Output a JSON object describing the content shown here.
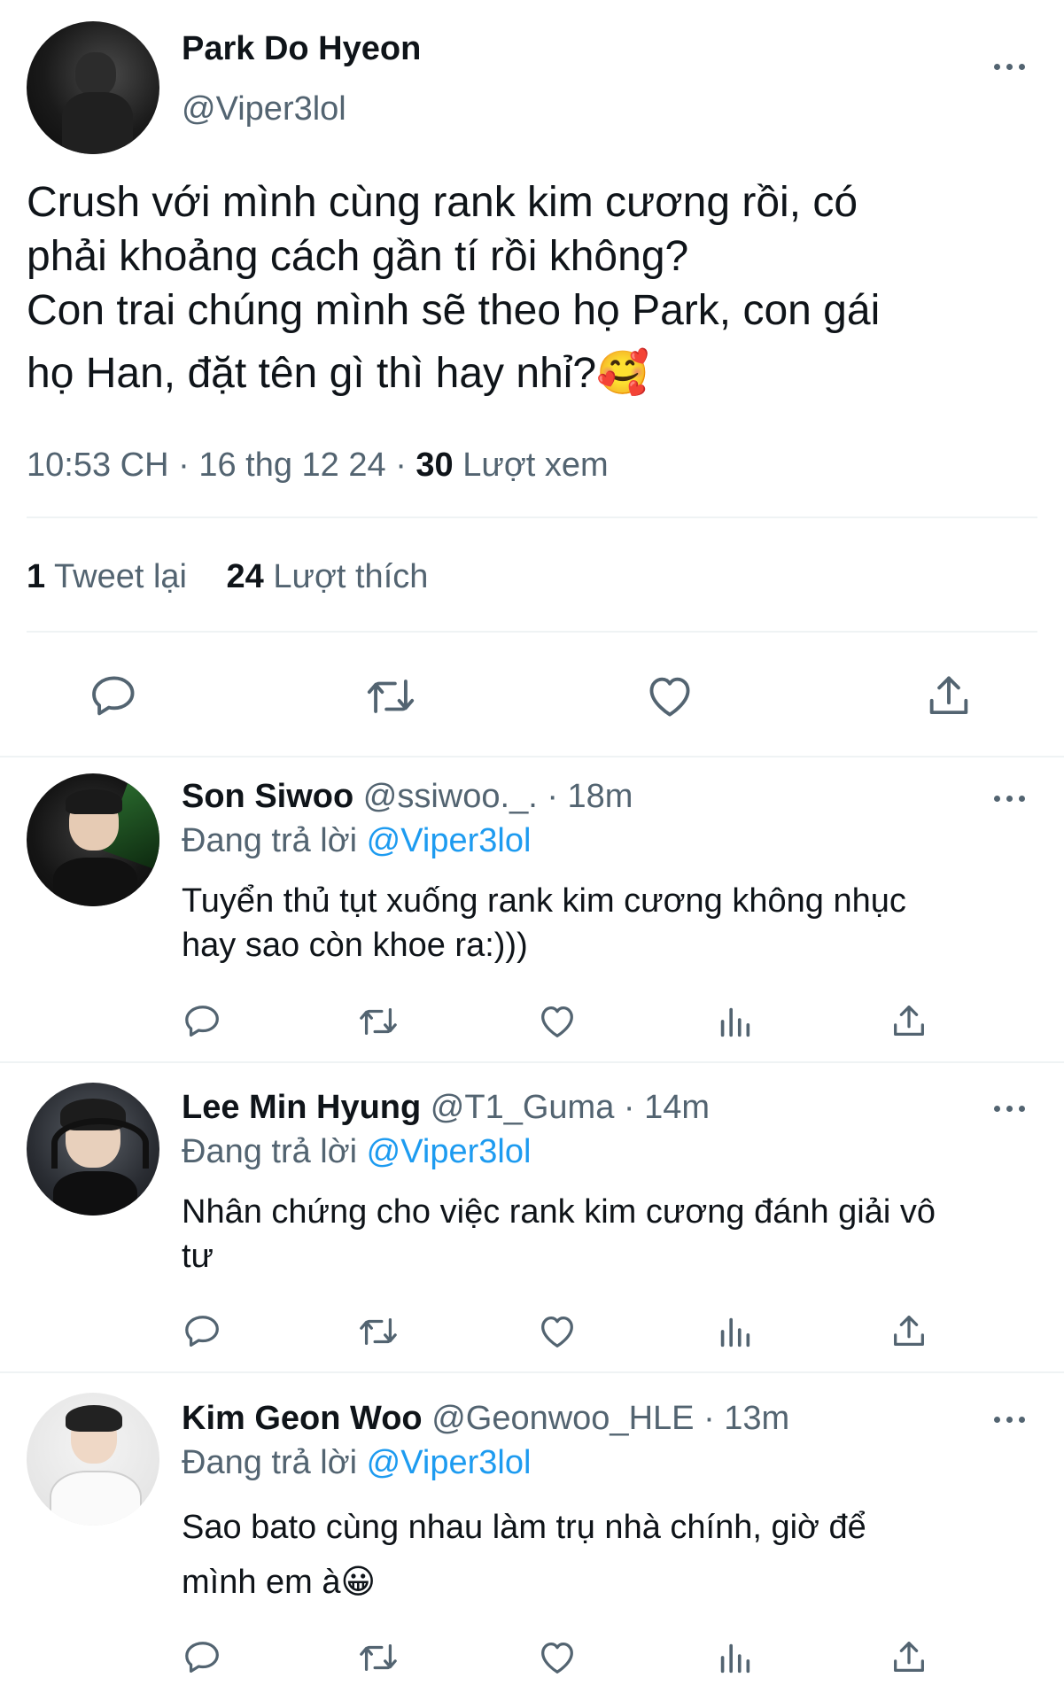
{
  "main_tweet": {
    "author_name": "Park Do Hyeon",
    "handle": "@Viper3lol",
    "text_lines": [
      "Crush với mình cùng rank kim cương rồi, có",
      "phải khoảng cách gần tí rồi không?",
      "Con trai chúng mình sẽ theo họ Park, con gái",
      "họ Han, đặt tên gì thì hay nhỉ?"
    ],
    "emoji": "🥰",
    "time": "10:53 CH",
    "date": "16 thg 12 24",
    "separator": "·",
    "views_count": "30",
    "views_label": "Lượt xem",
    "retweets_count": "1",
    "retweets_label": "Tweet lại",
    "likes_count": "24",
    "likes_label": "Lượt thích"
  },
  "replies": [
    {
      "author_name": "Son Siwoo",
      "handle": "@ssiwoo._.",
      "time": "· 18m",
      "replying_prefix": "Đang trả lời",
      "replying_to": "@Viper3lol",
      "text_lines": [
        "Tuyển thủ tụt xuống rank kim cương không nhục",
        "hay sao còn khoe ra:)))"
      ],
      "emoji": ""
    },
    {
      "author_name": "Lee Min Hyung",
      "handle": "@T1_Guma",
      "time": "· 14m",
      "replying_prefix": "Đang trả lời",
      "replying_to": "@Viper3lol",
      "text_lines": [
        "Nhân chứng cho việc rank kim cương đánh giải vô",
        "tư"
      ],
      "emoji": ""
    },
    {
      "author_name": "Kim Geon Woo",
      "handle": "@Geonwoo_HLE",
      "time": "· 13m",
      "replying_prefix": "Đang trả lời",
      "replying_to": "@Viper3lol",
      "text_lines": [
        "Sao bato cùng nhau làm trụ nhà chính, giờ để",
        "mình em à"
      ],
      "emoji": "😀"
    }
  ],
  "icons": [
    "reply-icon",
    "retweet-icon",
    "like-icon",
    "share-icon",
    "analytics-icon",
    "more-icon"
  ],
  "colors": {
    "link_blue": "#1d9bf0",
    "secondary_text": "#536471",
    "divider": "#eff3f4"
  }
}
